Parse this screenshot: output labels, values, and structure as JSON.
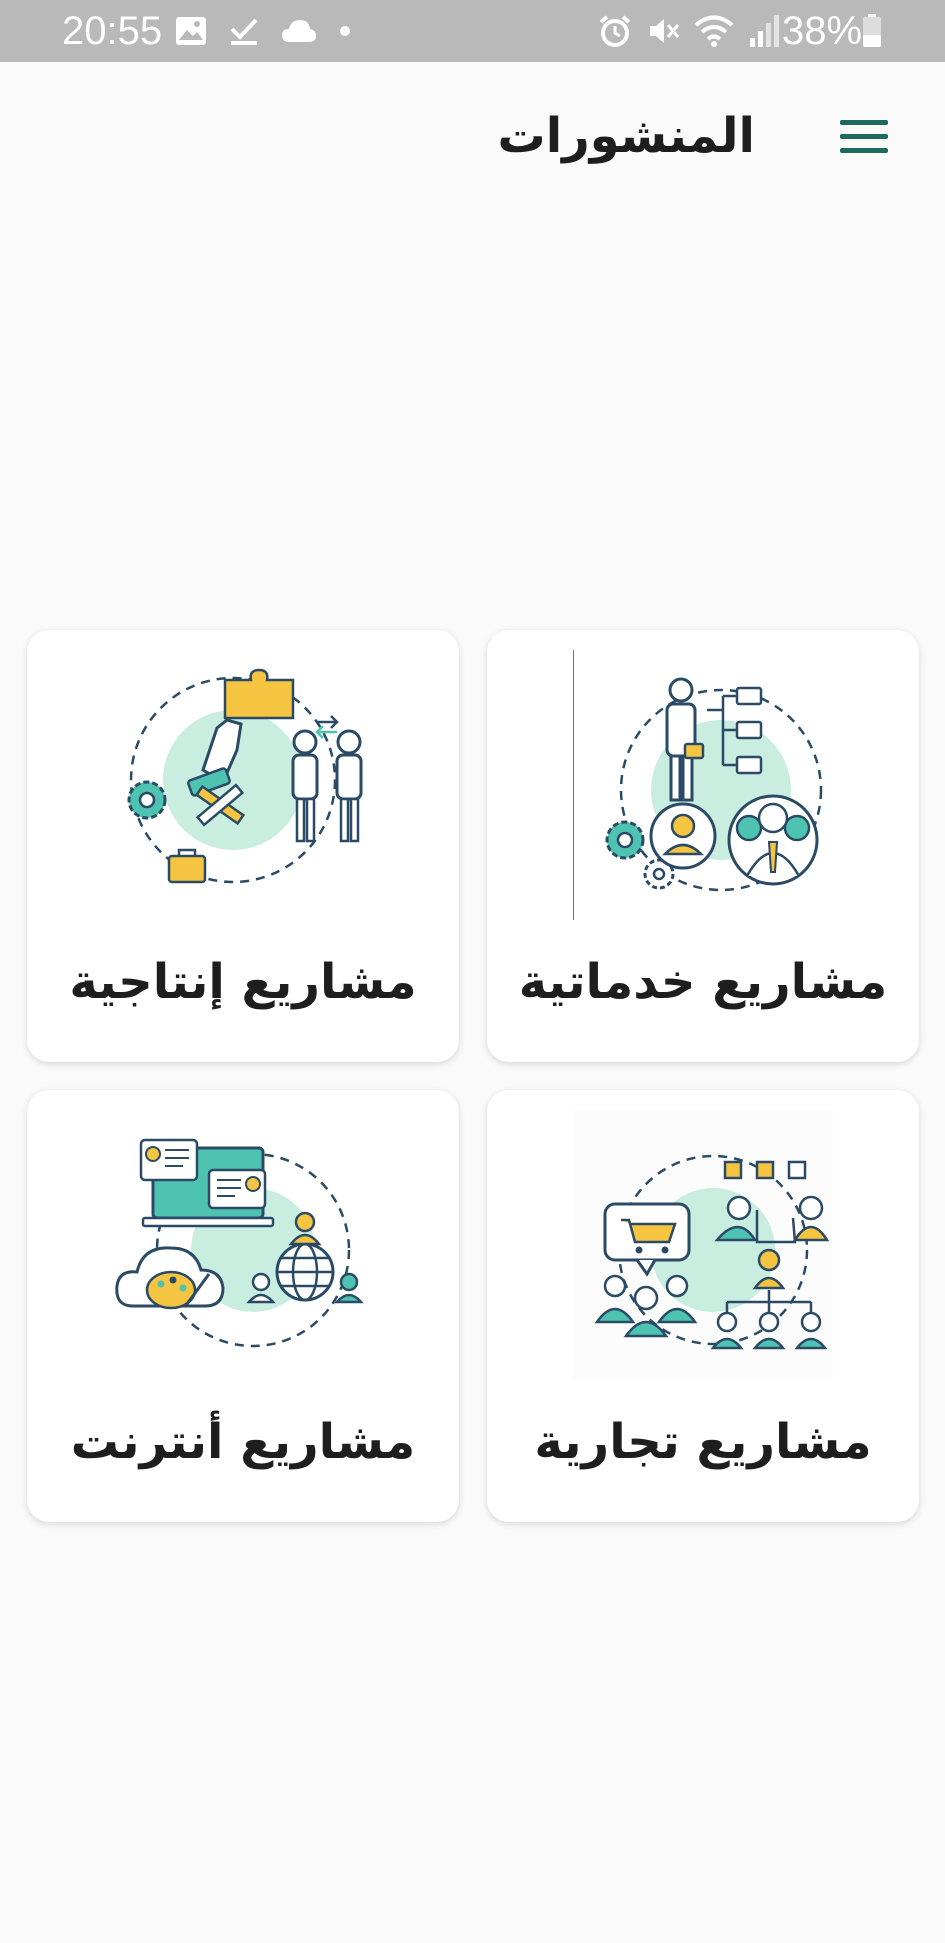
{
  "status_bar": {
    "time": "20:55",
    "battery_text": "38%",
    "left_icons": [
      "gallery-icon",
      "checkmark-icon",
      "cloud-icon",
      "dot-icon"
    ],
    "right_icons": [
      "alarm-icon",
      "mute-icon",
      "wifi-icon",
      "signal-icon",
      "battery-icon"
    ]
  },
  "app_bar": {
    "title": "المنشورات",
    "menu_icon": "menu-icon"
  },
  "colors": {
    "accent": "#1d6b5e",
    "mint": "#c9eee0",
    "teal": "#4fc3b1",
    "yellow": "#f5c542",
    "outline": "#2a4a66",
    "status_bar": "#b8b9b8",
    "background": "#f9faf9",
    "text": "#1e1e1e"
  },
  "categories": [
    {
      "label": "مشاريع خدماتية",
      "icon": "services-illustration"
    },
    {
      "label": "مشاريع إنتاجية",
      "icon": "production-illustration"
    },
    {
      "label": "مشاريع تجارية",
      "icon": "commercial-illustration"
    },
    {
      "label": "مشاريع أنترنت",
      "icon": "internet-illustration"
    }
  ]
}
